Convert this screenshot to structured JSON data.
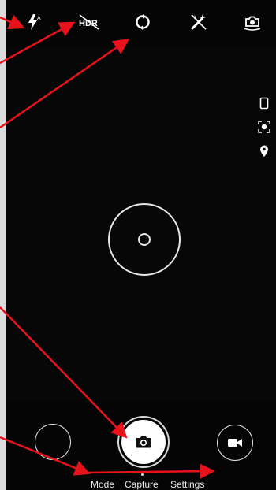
{
  "top_bar": {
    "icons": [
      "flash-auto-icon",
      "hdr-off-icon",
      "switch-camera-icon",
      "effects-off-icon",
      "camera-settings-icon"
    ],
    "hdr_label": "HDR"
  },
  "side_bar": {
    "icons": [
      "aspect-ratio-icon",
      "face-detect-icon",
      "location-icon"
    ]
  },
  "bottom_bar": {
    "modes": {
      "mode": "Mode",
      "capture": "Capture",
      "settings": "Settings"
    }
  },
  "annotations": {
    "arrow_color": "#e8121b",
    "arrow_count": 6
  },
  "colors": {
    "background": "#050505",
    "icon": "#ffffff",
    "shutter": "#ffffff"
  }
}
